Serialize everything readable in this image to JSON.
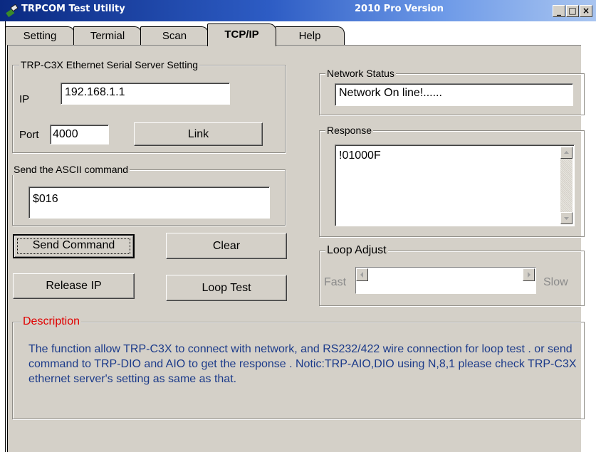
{
  "window": {
    "title": "TRPCOM Test Utility",
    "version": "2010 Pro Version",
    "minimize_label": "_",
    "maximize_label": "□",
    "close_label": "×"
  },
  "tabs": [
    {
      "label": "Setting"
    },
    {
      "label": "Termial"
    },
    {
      "label": "Scan"
    },
    {
      "label": "TCP/IP"
    },
    {
      "label": "Help"
    }
  ],
  "server_setting": {
    "legend": "TRP-C3X Ethernet Serial Server Setting",
    "ip_label": "IP",
    "ip_value": "192.168.1.1",
    "port_label": "Port",
    "port_value": "4000",
    "link_button": "Link"
  },
  "ascii_command": {
    "legend": "Send the ASCII command",
    "value": "$016"
  },
  "buttons": {
    "send_command": "Send Command",
    "clear": "Clear",
    "release_ip": "Release IP",
    "loop_test": "Loop Test"
  },
  "network_status": {
    "legend": "Network Status",
    "value": "Network On line!......"
  },
  "response": {
    "legend": "Response",
    "value": "!01000F"
  },
  "loop_adjust": {
    "legend": "Loop Adjust",
    "fast_label": "Fast",
    "slow_label": "Slow"
  },
  "description": {
    "legend": "Description",
    "legend_color": "#e00000",
    "text_color": "#1c3b8a",
    "text": "The function allow TRP-C3X to connect with network, and RS232/422 wire connection for loop test . or send command to TRP-DIO and AIO  to get the response . Notic:TRP-AIO,DIO using N,8,1 please check TRP-C3X ethernet server's  setting  as same as that."
  },
  "colors": {
    "titlebar_start": "#0b2a82",
    "titlebar_end": "#a9c5f0",
    "panel": "#d4d0c8"
  }
}
